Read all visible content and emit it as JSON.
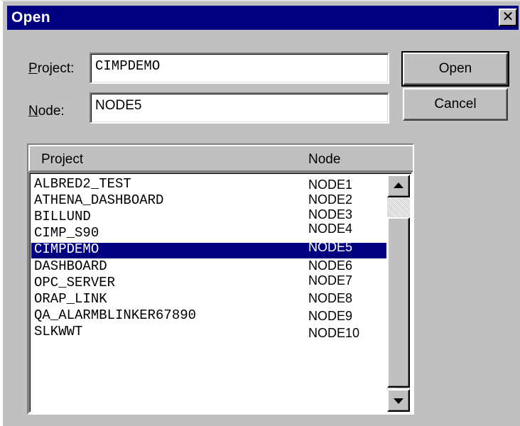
{
  "window": {
    "title": "Open",
    "close_glyph": "✕",
    "close_icon": "close-icon"
  },
  "form": {
    "project_label_accel": "P",
    "project_label_rest": "roject:",
    "project_value": "CIMPDEMO",
    "node_label_accel": "N",
    "node_label_rest": "ode:",
    "node_value": "NODE5"
  },
  "buttons": {
    "open_label": "Open",
    "cancel_label": "Cancel"
  },
  "list": {
    "columns": [
      "Project",
      "Node"
    ],
    "selected_index": 4,
    "rows": [
      {
        "project": "ALBRED2_TEST",
        "node": "NODE1"
      },
      {
        "project": "ATHENA_DASHBOARD",
        "node": "NODE2"
      },
      {
        "project": "BILLUND",
        "node": "NODE3"
      },
      {
        "project": "CIMP_S90",
        "node": "NODE4"
      },
      {
        "project": "CIMPDEMO",
        "node": "NODE5"
      },
      {
        "project": "DASHBOARD",
        "node": "NODE6"
      },
      {
        "project": "OPC_SERVER",
        "node": "NODE7"
      },
      {
        "project": "ORAP_LINK",
        "node": "NODE8"
      },
      {
        "project": "QA_ALARMBLINKER67890",
        "node": "NODE9"
      },
      {
        "project": "SLKWWT",
        "node": "NODE10"
      }
    ]
  },
  "colors": {
    "face": "#c0c0c0",
    "titlebar": "#000080",
    "selection": "#000080",
    "selection_text": "#ffffff"
  }
}
